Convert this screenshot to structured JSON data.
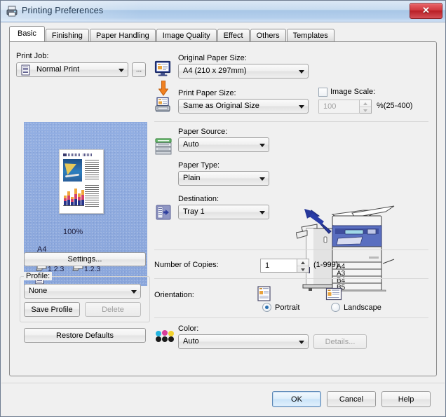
{
  "window": {
    "title": "Printing Preferences",
    "icon": "printer-icon",
    "close_label": "✕"
  },
  "tabs": [
    {
      "label": "Basic",
      "selected": true
    },
    {
      "label": "Finishing",
      "selected": false
    },
    {
      "label": "Paper Handling",
      "selected": false
    },
    {
      "label": "Image Quality",
      "selected": false
    },
    {
      "label": "Effect",
      "selected": false
    },
    {
      "label": "Others",
      "selected": false
    },
    {
      "label": "Templates",
      "selected": false
    }
  ],
  "left_panel": {
    "print_job_label": "Print Job:",
    "print_job_value": "Normal Print",
    "print_job_browse_label": "...",
    "preview": {
      "scale_text": "100%",
      "paper_text": "A4",
      "copy_order_left": "1.2.3",
      "copy_order_right": "1.2.3"
    },
    "settings_button": "Settings...",
    "profile_group_label": "Profile:",
    "profile_value": "None",
    "save_profile_button": "Save Profile",
    "delete_button": "Delete",
    "restore_defaults_button": "Restore Defaults"
  },
  "right_panel": {
    "original_paper_size_label": "Original Paper Size:",
    "original_paper_size_value": "A4 (210 x 297mm)",
    "print_paper_size_label": "Print Paper Size:",
    "print_paper_size_value": "Same as Original Size",
    "image_scale_label": "Image Scale:",
    "image_scale_checked": false,
    "image_scale_value": "100",
    "image_scale_range": "%(25-400)",
    "paper_source_label": "Paper Source:",
    "paper_source_value": "Auto",
    "paper_type_label": "Paper Type:",
    "paper_type_value": "Plain",
    "destination_label": "Destination:",
    "destination_value": "Tray 1",
    "printer_trays": [
      "A4",
      "A3",
      "B4",
      "B5"
    ],
    "number_of_copies_label": "Number of Copies:",
    "number_of_copies_value": "1",
    "number_of_copies_range": "(1-999)",
    "orientation_label": "Orientation:",
    "orientation_portrait": "Portrait",
    "orientation_landscape": "Landscape",
    "orientation_selected": "Portrait",
    "color_label": "Color:",
    "color_value": "Auto",
    "color_details_button": "Details..."
  },
  "footer": {
    "ok_button": "OK",
    "cancel_button": "Cancel",
    "help_button": "Help"
  },
  "colors": {
    "title_accent": "#a8c6e6",
    "close_red": "#b91e25",
    "preview_blue": "#8ba8dd",
    "arrow_orange": "#f08020",
    "tray_green": "#4caf50",
    "radio_blue": "#2a6fb0"
  }
}
